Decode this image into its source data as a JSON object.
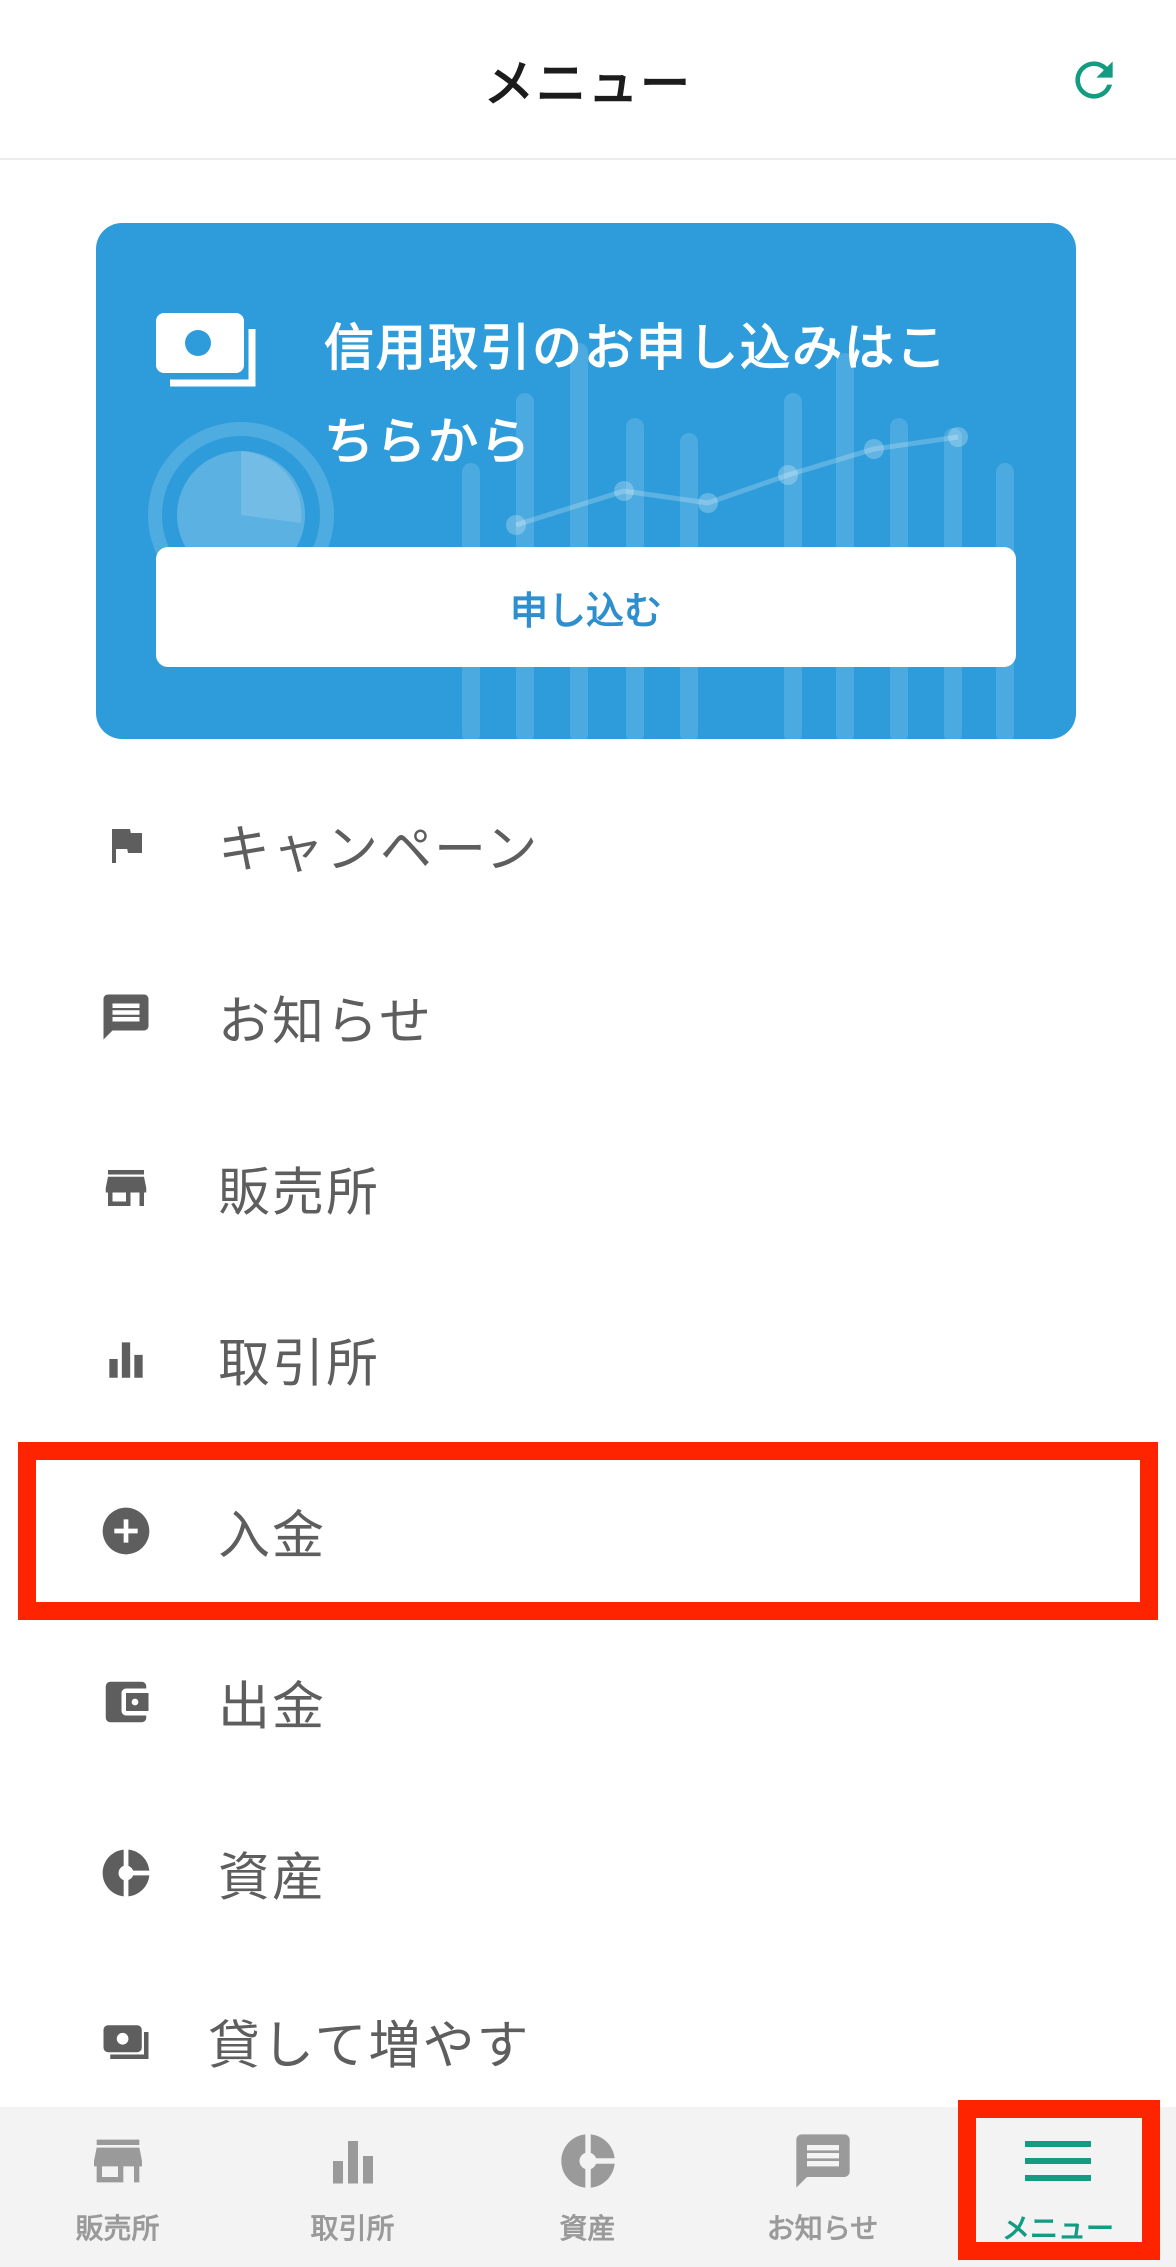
{
  "header": {
    "title": "メニュー",
    "refresh_icon": "refresh-icon"
  },
  "banner": {
    "text_line1": "信用取引のお申し込みはこ",
    "text_line2": "ちらから",
    "button_label": "申し込む",
    "icon": "money-icon"
  },
  "menu": {
    "items": [
      {
        "label": "キャンペーン",
        "icon": "flag-icon"
      },
      {
        "label": "お知らせ",
        "icon": "message-icon"
      },
      {
        "label": "販売所",
        "icon": "store-icon"
      },
      {
        "label": "取引所",
        "icon": "bar-chart-icon"
      },
      {
        "label": "入金",
        "icon": "add-circle-icon"
      },
      {
        "label": "出金",
        "icon": "wallet-icon"
      },
      {
        "label": "資産",
        "icon": "pie-chart-icon"
      },
      {
        "label": "貸して増やす",
        "icon": "money-icon"
      }
    ]
  },
  "bottom_nav": {
    "items": [
      {
        "label": "販売所",
        "icon": "store-icon",
        "active": false
      },
      {
        "label": "取引所",
        "icon": "bar-chart-icon",
        "active": false
      },
      {
        "label": "資産",
        "icon": "pie-chart-icon",
        "active": false
      },
      {
        "label": "お知らせ",
        "icon": "message-icon",
        "active": false
      },
      {
        "label": "メニュー",
        "icon": "hamburger-menu-icon",
        "active": true
      }
    ]
  },
  "colors": {
    "accent": "#139c82",
    "banner": "#2e9cda",
    "highlight": "#ff2400",
    "menu_text": "#5e5e5e",
    "nav_inactive": "#9a9a9a"
  }
}
